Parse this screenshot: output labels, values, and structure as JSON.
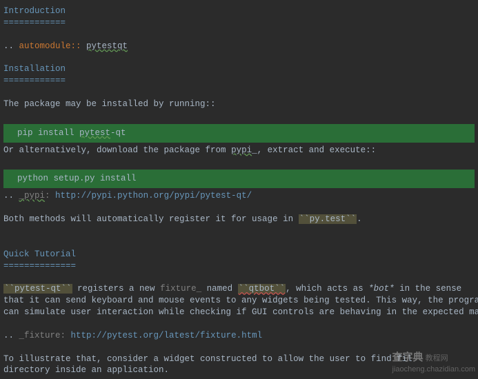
{
  "sections": {
    "intro": {
      "title": "Introduction",
      "underline": "============"
    },
    "install": {
      "title": "Installation",
      "underline": "============"
    },
    "tutorial": {
      "title": "Quick Tutorial",
      "underline": "=============="
    }
  },
  "automodule": {
    "prefix": ".. ",
    "directive": "automodule::",
    "space": " ",
    "target": "pytestqt"
  },
  "install_text": "The package may be installed by running::",
  "code1": {
    "prefix": "pip install ",
    "pkg": "pytest",
    "suffix": "-qt"
  },
  "alt_text": {
    "p1": "Or alternatively, download the package from ",
    "link": "pypi",
    "underscore": "_",
    "p2": ", extract and execute::"
  },
  "code2": "python setup.py install",
  "pypi_link": {
    "prefix": ".. ",
    "name": "_pypi",
    "colon": ": ",
    "url": "http://pypi.python.org/pypi/pytest-qt/"
  },
  "both_methods": {
    "p1": "Both methods will automatically register it for usage in ",
    "lit": "``py.test``",
    "dot": "."
  },
  "tutorial_body": {
    "lit1": "``pytest-qt``",
    "p1": " registers a new ",
    "fixture": "fixture",
    "underscore": "_",
    "p2": " named ",
    "lit2": "``qtbot``",
    "p3": ", which acts as ",
    "bot": "*bot*",
    "p4": " in the sense",
    "line2": "that it can send keyboard and mouse events to any widgets being tested. This way, the programmer",
    "line3": "can simulate user interaction while checking if GUI controls are behaving in the expected manner."
  },
  "fixture_link": {
    "prefix": ".. ",
    "name": "_fixture: ",
    "url": "http://pytest.org/latest/fixture.html"
  },
  "illustrate": {
    "line1": "To illustrate that, consider a widget constructed to allow the user to find fil",
    "line2": "directory inside an application."
  },
  "watermark": {
    "site": "查字典",
    "sub": "教程网",
    "url": "jiaocheng.chazidian.com"
  }
}
